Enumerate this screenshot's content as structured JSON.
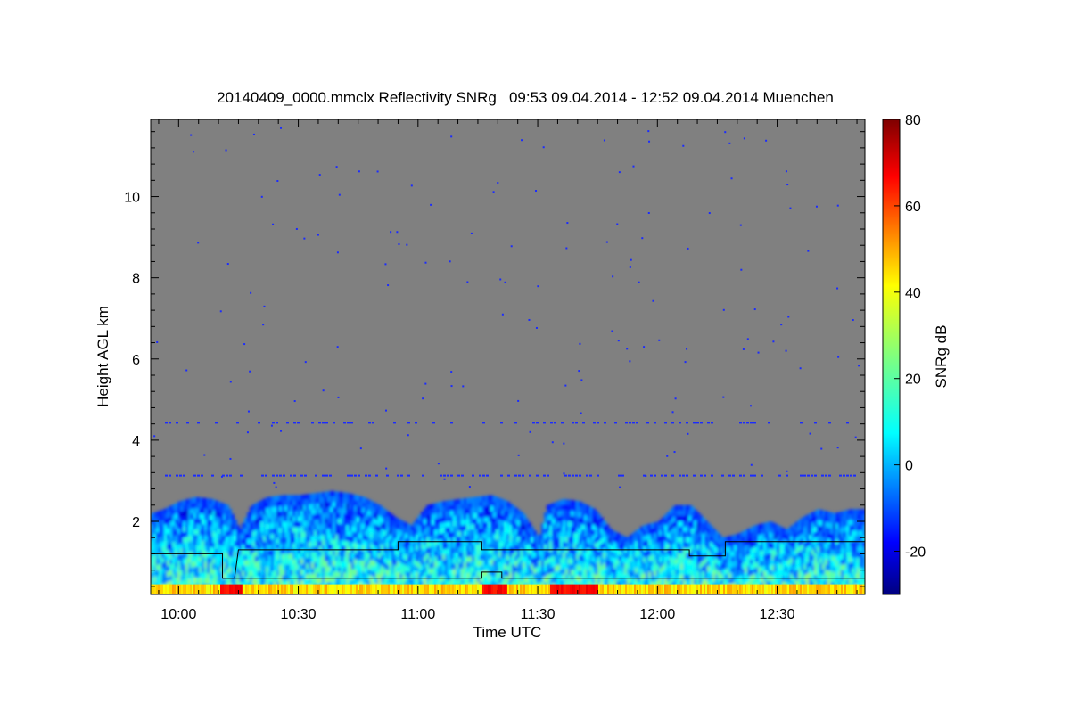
{
  "chart_data": {
    "type": "heatmap",
    "title": "20140409_0000.mmclx Reflectivity SNRg   09:53 09.04.2014 - 12:52 09.04.2014 Muenchen",
    "xlabel": "Time UTC",
    "ylabel": "Height AGL km",
    "colorbar_label": "SNRg dB",
    "x_range_minutes": [
      593,
      772
    ],
    "x_ticks": [
      {
        "label": "10:00",
        "minutes": 600
      },
      {
        "label": "10:30",
        "minutes": 630
      },
      {
        "label": "11:00",
        "minutes": 660
      },
      {
        "label": "11:30",
        "minutes": 690
      },
      {
        "label": "12:00",
        "minutes": 720
      },
      {
        "label": "12:30",
        "minutes": 750
      }
    ],
    "y_range_km": [
      0.2,
      11.9
    ],
    "y_ticks": [
      {
        "label": "2",
        "value": 2
      },
      {
        "label": "4",
        "value": 4
      },
      {
        "label": "6",
        "value": 6
      },
      {
        "label": "8",
        "value": 8
      },
      {
        "label": "10",
        "value": 10
      }
    ],
    "colorbar_range": [
      -30,
      80
    ],
    "colorbar_ticks": [
      {
        "label": "-20",
        "value": -20
      },
      {
        "label": "0",
        "value": 0
      },
      {
        "label": "20",
        "value": 20
      },
      {
        "label": "40",
        "value": 40
      },
      {
        "label": "60",
        "value": 60
      },
      {
        "label": "80",
        "value": 80
      }
    ],
    "background_color": "#808080",
    "colormap": "jet",
    "cloud_top_profile_km": [
      [
        593,
        2.2
      ],
      [
        596,
        2.3
      ],
      [
        600,
        2.5
      ],
      [
        604,
        2.6
      ],
      [
        608,
        2.55
      ],
      [
        612,
        2.4
      ],
      [
        615,
        1.8
      ],
      [
        618,
        2.4
      ],
      [
        622,
        2.6
      ],
      [
        626,
        2.65
      ],
      [
        630,
        2.65
      ],
      [
        634,
        2.7
      ],
      [
        638,
        2.75
      ],
      [
        642,
        2.7
      ],
      [
        646,
        2.6
      ],
      [
        650,
        2.4
      ],
      [
        654,
        2.1
      ],
      [
        658,
        1.9
      ],
      [
        662,
        2.4
      ],
      [
        666,
        2.5
      ],
      [
        670,
        2.55
      ],
      [
        674,
        2.6
      ],
      [
        678,
        2.65
      ],
      [
        682,
        2.5
      ],
      [
        686,
        2.2
      ],
      [
        690,
        1.6
      ],
      [
        692,
        2.4
      ],
      [
        696,
        2.55
      ],
      [
        700,
        2.5
      ],
      [
        704,
        2.3
      ],
      [
        708,
        1.8
      ],
      [
        712,
        1.6
      ],
      [
        716,
        1.9
      ],
      [
        720,
        2.0
      ],
      [
        724,
        2.4
      ],
      [
        728,
        2.4
      ],
      [
        732,
        2.0
      ],
      [
        736,
        1.6
      ],
      [
        740,
        1.7
      ],
      [
        744,
        1.9
      ],
      [
        748,
        2.0
      ],
      [
        752,
        1.8
      ],
      [
        756,
        2.1
      ],
      [
        760,
        2.3
      ],
      [
        764,
        2.2
      ],
      [
        768,
        2.3
      ],
      [
        772,
        2.3
      ]
    ],
    "boundary_line_upper_km": [
      [
        593,
        1.2
      ],
      [
        611,
        1.2
      ],
      [
        611,
        0.6
      ],
      [
        614,
        0.6
      ],
      [
        615,
        1.3
      ],
      [
        655,
        1.3
      ],
      [
        655,
        1.5
      ],
      [
        676,
        1.5
      ],
      [
        676,
        1.3
      ],
      [
        728,
        1.3
      ],
      [
        728,
        1.15
      ],
      [
        737,
        1.15
      ],
      [
        737,
        1.5
      ],
      [
        772,
        1.5
      ]
    ],
    "boundary_line_lower_km": [
      [
        611,
        0.6
      ],
      [
        676,
        0.6
      ],
      [
        676,
        0.75
      ],
      [
        681,
        0.75
      ],
      [
        681,
        0.6
      ],
      [
        772,
        0.6
      ]
    ],
    "boundary_line_color": "#000000"
  }
}
